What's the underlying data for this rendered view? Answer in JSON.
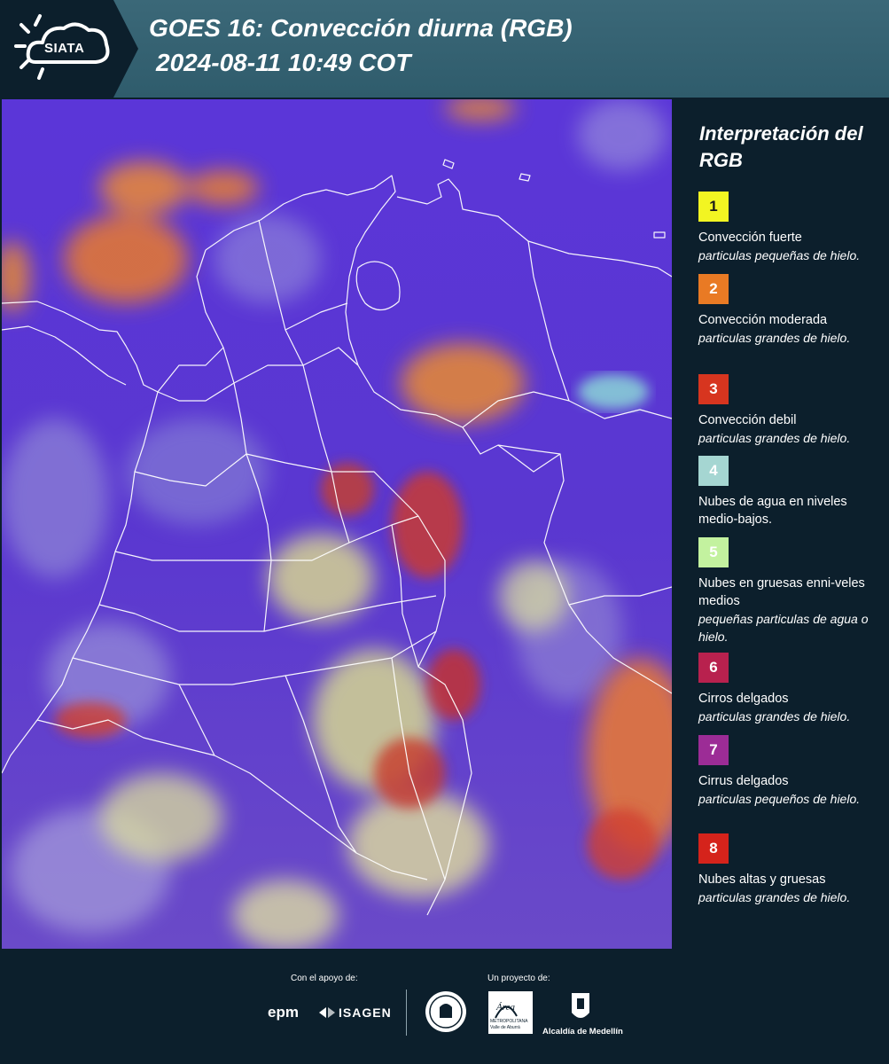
{
  "header": {
    "logo_text": "SIATA",
    "title_line1": "GOES 16: Convección diurna (RGB)",
    "title_line2": "2024-08-11 10:49 COT"
  },
  "legend": {
    "title": "Interpretación del RGB",
    "items": [
      {
        "number": "1",
        "label": "Convección fuerte",
        "desc": "particulas pequeñas de hielo.",
        "color": "#f2f522",
        "text_color": "#1a1a1a"
      },
      {
        "number": "2",
        "label": "Convección moderada",
        "desc": "particulas grandes de hielo.",
        "color": "#e97a24",
        "text_color": "#ffffff"
      },
      {
        "number": "3",
        "label": "Convección debil",
        "desc": "particulas grandes de hielo.",
        "color": "#d7351f",
        "text_color": "#ffffff"
      },
      {
        "number": "4",
        "label": "Nubes de agua en niveles medio-bajos.",
        "desc": "",
        "color": "#a5d6d2",
        "text_color": "#ffffff"
      },
      {
        "number": "5",
        "label": "Nubes en gruesas enni-veles medios",
        "desc": "pequeñas particulas de agua o hielo.",
        "color": "#c3f29f",
        "text_color": "#ffffff"
      },
      {
        "number": "6",
        "label": "Cirros delgados",
        "desc": "particulas grandes de hielo.",
        "color": "#b8214e",
        "text_color": "#ffffff"
      },
      {
        "number": "7",
        "label": "Cirrus delgados",
        "desc": "particulas pequeños de hielo.",
        "color": "#9c2c96",
        "text_color": "#ffffff"
      },
      {
        "number": "8",
        "label": "Nubes altas y gruesas",
        "desc": "particulas grandes de hielo.",
        "color": "#d5231b",
        "text_color": "#ffffff"
      }
    ]
  },
  "footer": {
    "support_label": "Con el apoyo de:",
    "project_label": "Un proyecto de:",
    "sponsors": {
      "epm": "epm",
      "isagen": "ISAGEN",
      "area_line1": "Área",
      "area_line2": "METROPOLITANA",
      "area_line3": "Valle de Aburrá",
      "alcaldia": "Alcaldía de Medellín"
    }
  }
}
